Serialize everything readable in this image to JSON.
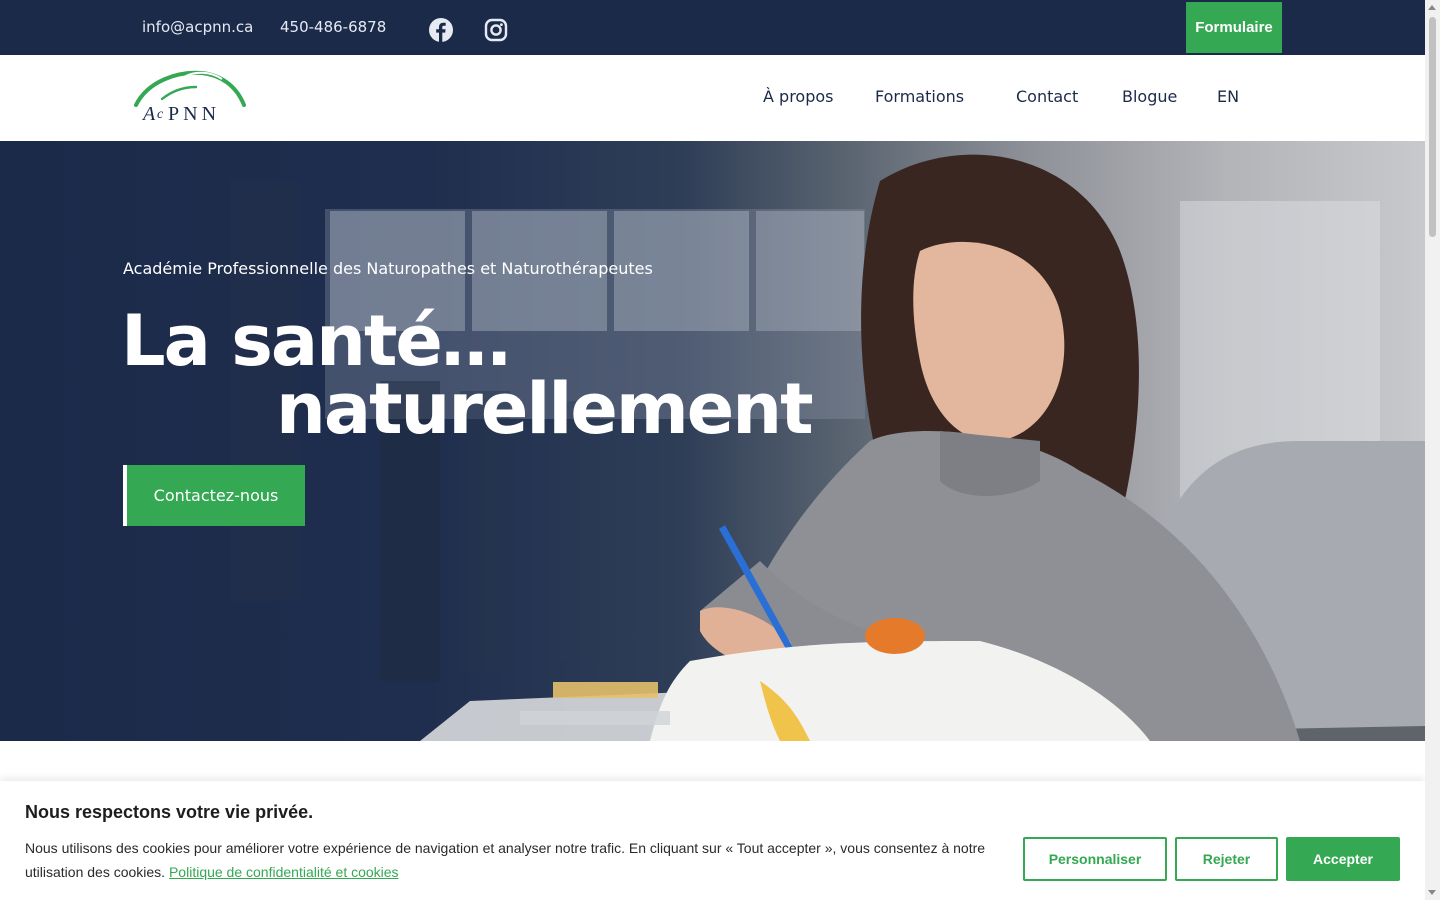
{
  "topbar": {
    "email": "info@acpnn.ca",
    "phone": "450-486-6878",
    "formulaire_label": "Formulaire",
    "icons": [
      "facebook-icon",
      "instagram-icon"
    ]
  },
  "header": {
    "logo_text": "AcPNN",
    "nav": [
      "À propos",
      "Formations",
      "Contact",
      "Blogue",
      "EN"
    ]
  },
  "hero": {
    "subtitle": "Académie Professionnelle des Naturopathes et Naturothérapeutes",
    "title_line1": "La santé…",
    "title_line2": "naturellement",
    "cta_label": "Contactez-nous"
  },
  "cookie": {
    "title": "Nous respectons votre vie privée.",
    "text": "Nous utilisons des cookies pour améliorer votre expérience de navigation et analyser notre trafic. En cliquant sur « Tout accepter », vous consentez à notre utilisation des cookies.",
    "link": "Politique de confidentialité et cookies",
    "customize": "Personnaliser",
    "reject": "Rejeter",
    "accept": "Accepter"
  },
  "colors": {
    "navy": "#1c2a4a",
    "green": "#34a853",
    "white": "#ffffff"
  }
}
